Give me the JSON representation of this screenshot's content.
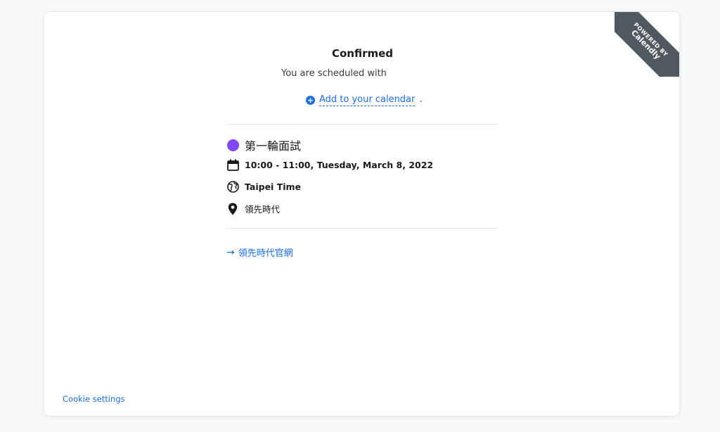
{
  "ribbon": {
    "line1": "POWERED BY",
    "line2": "Calendly"
  },
  "header": {
    "title": "Confirmed",
    "subtitle": "You are scheduled with"
  },
  "add_to_calendar": {
    "label": "Add to your calendar",
    "plus_symbol": "+",
    "chevron": "⌄"
  },
  "event": {
    "name": "第一輪面試",
    "dot_color": "#8247f5",
    "time": "10:00 - 11:00, Tuesday, March 8, 2022",
    "timezone": "Taipei Time",
    "location": "領先時代",
    "icons": {
      "time": "calendar-icon",
      "timezone": "globe-icon",
      "location": "location-pin-icon"
    }
  },
  "website_link": {
    "label": "領先時代官網",
    "icon": "arrow-right-icon"
  },
  "footer": {
    "cookie_settings": "Cookie settings"
  },
  "colors": {
    "accent": "#1a6fe6",
    "ribbon": "#505860"
  }
}
